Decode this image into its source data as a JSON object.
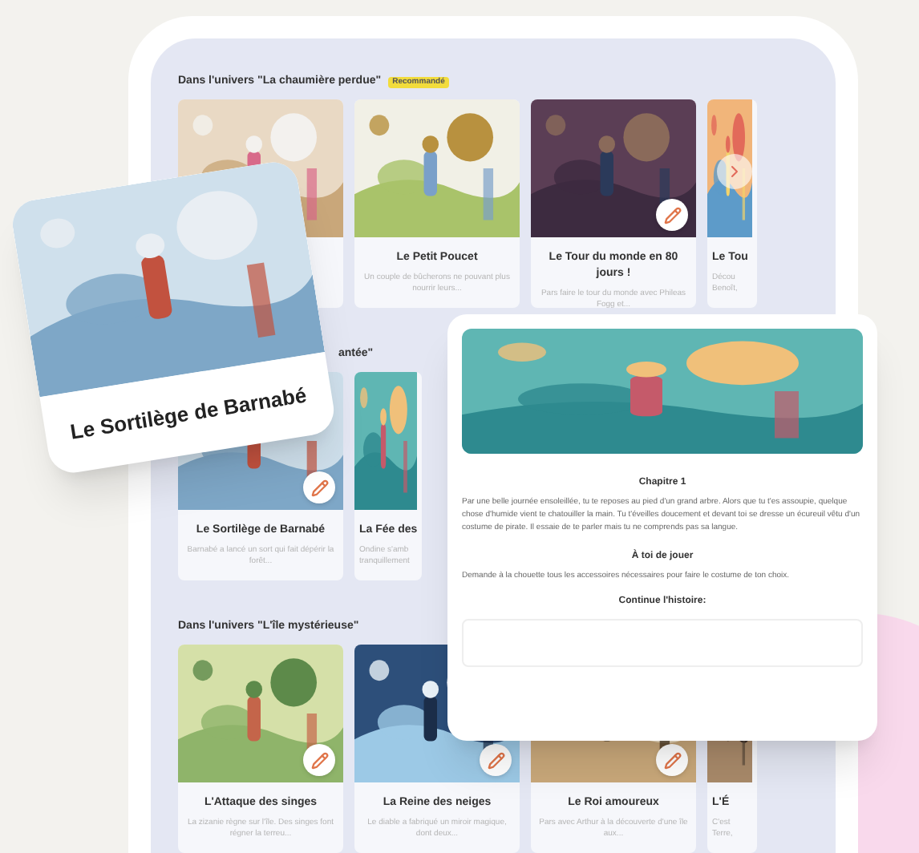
{
  "sections": [
    {
      "heading": "Dans l'univers \"La chaumière perdue\"",
      "badge": "Recommandé",
      "scroll_arrow": true,
      "cards": [
        {
          "kind": "hidden"
        },
        {
          "kind": "full",
          "title": "Le Petit Poucet",
          "description": "Un couple de bûcherons ne pouvant plus nourrir leurs..."
        },
        {
          "kind": "full",
          "title": "Le Tour du monde en 80 jours !",
          "description": "Pars faire le tour du monde avec Phileas Fogg et...",
          "pencil_badge": true
        },
        {
          "kind": "cut",
          "title": "Le Tou",
          "description": "Décou\nBenoît,"
        }
      ]
    },
    {
      "heading": "antée\"",
      "cards": [
        {
          "kind": "full",
          "title": "Le Sortilège de Barnabé",
          "description": "Barnabé a lancé un sort qui fait dépérir la forêt...",
          "pencil_badge": true
        },
        {
          "kind": "cut",
          "title": "La Fée des",
          "description": "Ondine s'amb\ntranquillement"
        }
      ]
    },
    {
      "heading": "Dans l'univers \"L'île mystérieuse\"",
      "cards": [
        {
          "kind": "full",
          "title": "L'Attaque des singes",
          "description": "La zizanie règne sur l'île. Des singes font régner la terreu...",
          "pencil_badge": true
        },
        {
          "kind": "full",
          "title": "La Reine des neiges",
          "description": "Le diable a fabriqué un miroir magique, dont deux...",
          "pencil_badge": true
        },
        {
          "kind": "full",
          "title": "Le Roi amoureux",
          "description": "Pars avec Arthur à la découverte d'une île aux...",
          "pencil_badge": true
        },
        {
          "kind": "cut",
          "title": "L'É",
          "description": "C'est\nTerre,"
        }
      ]
    }
  ],
  "featured_card": {
    "title": "Le Sortilège de Barnabé"
  },
  "chapter_panel": {
    "chapter_title": "Chapitre 1",
    "chapter_text": "Par une belle journée ensoleillée, tu te reposes au pied d'un grand arbre. Alors que tu t'es assoupie, quelque chose d'humide vient te chatouiller la main. Tu t'éveilles doucement et devant toi se dresse un écureuil vêtu d'un costume de pirate. Il essaie de te parler mais tu ne comprends pas sa langue.",
    "task_title": "À toi de jouer",
    "task_text": "Demande à la chouette tous les accessoires nécessaires pour faire le costume de ton choix.",
    "continue_label": "Continue l'histoire:"
  }
}
